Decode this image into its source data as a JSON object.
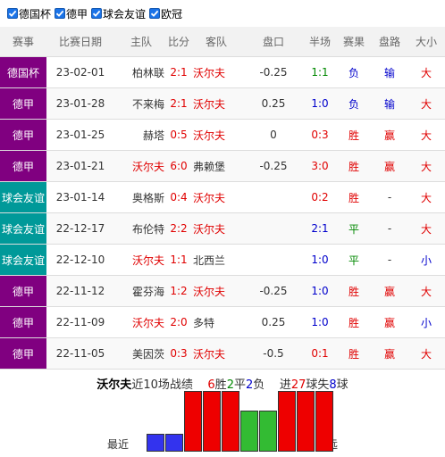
{
  "filters": [
    {
      "label": "德国杯",
      "checked": true
    },
    {
      "label": "德甲",
      "checked": true
    },
    {
      "label": "球会友谊",
      "checked": true
    },
    {
      "label": "欧冠",
      "checked": true
    }
  ],
  "columns": [
    "赛事",
    "比赛日期",
    "主队",
    "比分",
    "客队",
    "盘口",
    "半场",
    "赛果",
    "盘路",
    "大小"
  ],
  "rows": [
    {
      "league": "德国杯",
      "league_color": "#800080",
      "date": "23-02-01",
      "home": "柏林联",
      "home_focus": false,
      "score": "2:1",
      "away": "沃尔夫",
      "away_focus": true,
      "handicap": "-0.25",
      "half": "1:1",
      "half_color": "#008800",
      "result": "负",
      "result_color": "#0000cc",
      "pan": "输",
      "pan_color": "#0000cc",
      "ou": "大",
      "ou_color": "#e00000"
    },
    {
      "league": "德甲",
      "league_color": "#800080",
      "date": "23-01-28",
      "home": "不来梅",
      "home_focus": false,
      "score": "2:1",
      "away": "沃尔夫",
      "away_focus": true,
      "handicap": "0.25",
      "half": "1:0",
      "half_color": "#0000cc",
      "result": "负",
      "result_color": "#0000cc",
      "pan": "输",
      "pan_color": "#0000cc",
      "ou": "大",
      "ou_color": "#e00000"
    },
    {
      "league": "德甲",
      "league_color": "#800080",
      "date": "23-01-25",
      "home": "赫塔",
      "home_focus": false,
      "score": "0:5",
      "away": "沃尔夫",
      "away_focus": true,
      "handicap": "0",
      "half": "0:3",
      "half_color": "#e00000",
      "result": "胜",
      "result_color": "#e00000",
      "pan": "赢",
      "pan_color": "#e00000",
      "ou": "大",
      "ou_color": "#e00000"
    },
    {
      "league": "德甲",
      "league_color": "#800080",
      "date": "23-01-21",
      "home": "沃尔夫",
      "home_focus": true,
      "score": "6:0",
      "away": "弗赖堡",
      "away_focus": false,
      "handicap": "-0.25",
      "half": "3:0",
      "half_color": "#e00000",
      "result": "胜",
      "result_color": "#e00000",
      "pan": "赢",
      "pan_color": "#e00000",
      "ou": "大",
      "ou_color": "#e00000"
    },
    {
      "league": "球会友谊",
      "league_color": "#009999",
      "date": "23-01-14",
      "home": "奥格斯",
      "home_focus": false,
      "score": "0:4",
      "away": "沃尔夫",
      "away_focus": true,
      "handicap": "",
      "half": "0:2",
      "half_color": "#e00000",
      "result": "胜",
      "result_color": "#e00000",
      "pan": "-",
      "pan_color": "#333333",
      "ou": "大",
      "ou_color": "#e00000"
    },
    {
      "league": "球会友谊",
      "league_color": "#009999",
      "date": "22-12-17",
      "home": "布伦特",
      "home_focus": false,
      "score": "2:2",
      "away": "沃尔夫",
      "away_focus": true,
      "handicap": "",
      "half": "2:1",
      "half_color": "#0000cc",
      "result": "平",
      "result_color": "#008800",
      "pan": "-",
      "pan_color": "#333333",
      "ou": "大",
      "ou_color": "#e00000"
    },
    {
      "league": "球会友谊",
      "league_color": "#009999",
      "date": "22-12-10",
      "home": "沃尔夫",
      "home_focus": true,
      "score": "1:1",
      "away": "北西兰",
      "away_focus": false,
      "handicap": "",
      "half": "1:0",
      "half_color": "#0000cc",
      "result": "平",
      "result_color": "#008800",
      "pan": "-",
      "pan_color": "#333333",
      "ou": "小",
      "ou_color": "#0000cc"
    },
    {
      "league": "德甲",
      "league_color": "#800080",
      "date": "22-11-12",
      "home": "霍芬海",
      "home_focus": false,
      "score": "1:2",
      "away": "沃尔夫",
      "away_focus": true,
      "handicap": "-0.25",
      "half": "1:0",
      "half_color": "#0000cc",
      "result": "胜",
      "result_color": "#e00000",
      "pan": "赢",
      "pan_color": "#e00000",
      "ou": "大",
      "ou_color": "#e00000"
    },
    {
      "league": "德甲",
      "league_color": "#800080",
      "date": "22-11-09",
      "home": "沃尔夫",
      "home_focus": true,
      "score": "2:0",
      "away": "多特",
      "away_focus": false,
      "handicap": "0.25",
      "half": "1:0",
      "half_color": "#0000cc",
      "result": "胜",
      "result_color": "#e00000",
      "pan": "赢",
      "pan_color": "#e00000",
      "ou": "小",
      "ou_color": "#0000cc"
    },
    {
      "league": "德甲",
      "league_color": "#800080",
      "date": "22-11-05",
      "home": "美因茨",
      "home_focus": false,
      "score": "0:3",
      "away": "沃尔夫",
      "away_focus": true,
      "handicap": "-0.5",
      "half": "0:1",
      "half_color": "#e00000",
      "result": "胜",
      "result_color": "#e00000",
      "pan": "赢",
      "pan_color": "#e00000",
      "ou": "大",
      "ou_color": "#e00000"
    }
  ],
  "summary": {
    "team": "沃尔夫",
    "text1": "近10场战绩",
    "wins": "6",
    "win_word": "胜",
    "draws": "2",
    "draw_word": "平",
    "losses": "2",
    "loss_word": "负",
    "goals_pre": "进",
    "goals_for": "27",
    "goals_mid": "球失",
    "goals_against": "8",
    "goals_post": "球"
  },
  "form_bars": {
    "label_left": "最近",
    "label_right": "最远",
    "results_recent_to_old": [
      "负",
      "负",
      "胜",
      "胜",
      "胜",
      "平",
      "平",
      "胜",
      "胜",
      "胜"
    ],
    "colors": {
      "胜": "#ee0000",
      "平": "#33bb33",
      "负": "#3333ee"
    }
  }
}
